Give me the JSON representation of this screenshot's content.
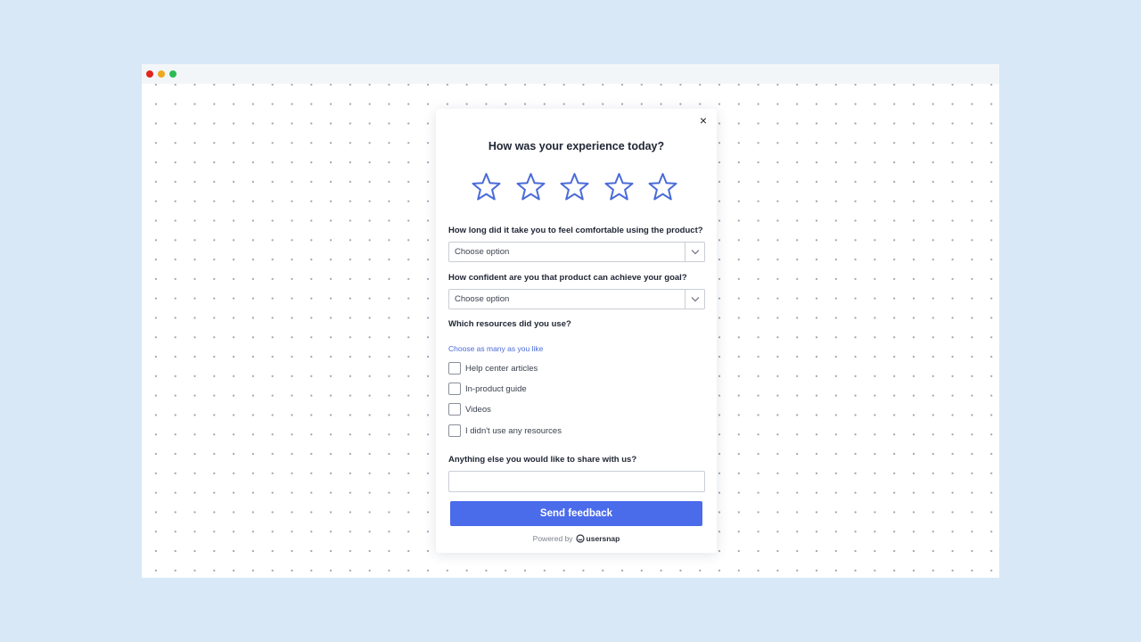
{
  "browser": {
    "window_controls": [
      "close",
      "minimize",
      "maximize"
    ]
  },
  "widget": {
    "close_label": "×",
    "title": "How was your experience today?",
    "rating": {
      "max": 5,
      "selected": 0,
      "star_color": "#4a6bd8"
    },
    "questions": {
      "q1": {
        "label": "How long did it take you to feel comfortable using the product?",
        "selected": "Choose option"
      },
      "q2": {
        "label": "How confident are you that product can achieve your goal?",
        "selected": "Choose option"
      },
      "q3": {
        "label": "Which resources did you use?",
        "hint": "Choose as many as you like",
        "options": [
          {
            "label": "Help center articles",
            "checked": false
          },
          {
            "label": "In-product guide",
            "checked": false
          },
          {
            "label": "Videos",
            "checked": false
          },
          {
            "label": "I didn't use any resources",
            "checked": false
          }
        ]
      },
      "q4": {
        "label": "Anything else you would like to share with us?",
        "value": ""
      }
    },
    "submit_label": "Send feedback",
    "powered_by": "Powered by",
    "brand": "usersnap"
  },
  "colors": {
    "background": "#d8e8f7",
    "accent": "#4a6bea",
    "hint": "#4a6bd8"
  }
}
